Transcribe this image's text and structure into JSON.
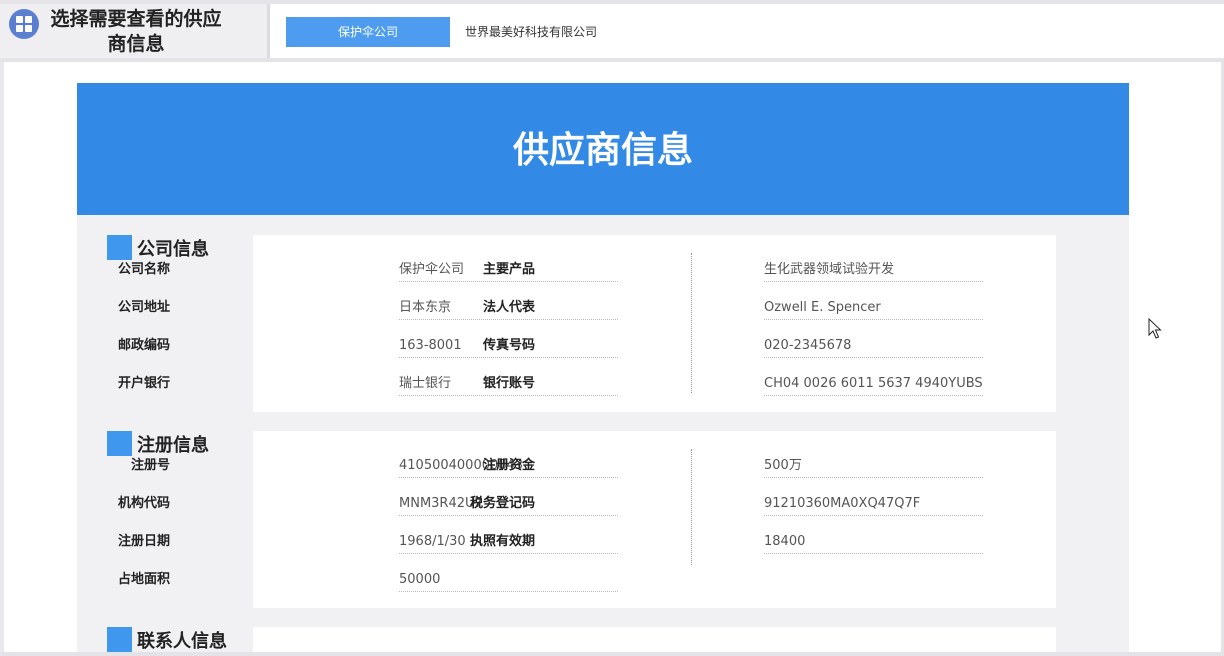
{
  "header": {
    "title": "选择需要查看的供应商信息",
    "tabs": [
      {
        "label": "保护伞公司",
        "active": true
      },
      {
        "label": "世界最美好科技有限公司",
        "active": false
      }
    ]
  },
  "report": {
    "banner_title": "供应商信息",
    "sections": {
      "company": {
        "title": "公司信息",
        "fields": [
          {
            "label": "公司名称",
            "value": "保护伞公司"
          },
          {
            "label": "主要产品",
            "value": "生化武器领域试验开发"
          },
          {
            "label": "公司地址",
            "value": "日本东京"
          },
          {
            "label": "法人代表",
            "value": "Ozwell E. Spencer"
          },
          {
            "label": "邮政编码",
            "value": "163-8001"
          },
          {
            "label": "传真号码",
            "value": "020-2345678"
          },
          {
            "label": "开户银行",
            "value": "瑞士银行"
          },
          {
            "label": "银行账号",
            "value": "CH04 0026 6011 5637 4940YUBS"
          }
        ]
      },
      "registration": {
        "title": "注册信息",
        "fields": [
          {
            "label": "注册号",
            "value": "410500400000843"
          },
          {
            "label": "注册资金",
            "value": "500万"
          },
          {
            "label": "机构代码",
            "value": "MNM3R42U7"
          },
          {
            "label": "税务登记码",
            "value": "91210360MA0XQ47Q7F"
          },
          {
            "label": "注册日期",
            "value": "1968/1/30"
          },
          {
            "label": "执照有效期",
            "value": "18400"
          },
          {
            "label": "占地面积",
            "value": "50000"
          }
        ]
      },
      "contact": {
        "title": "联系人信息"
      }
    }
  },
  "colors": {
    "banner": "#338ae6",
    "active_tab": "#4d9cf0",
    "section_marker": "#3f97ee"
  }
}
